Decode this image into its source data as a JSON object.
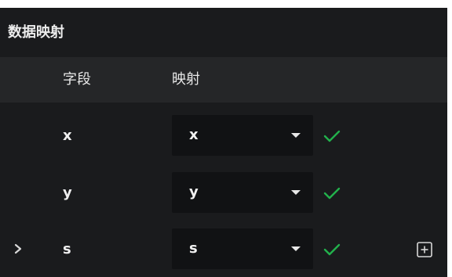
{
  "panel": {
    "title": "数据映射"
  },
  "table": {
    "headers": {
      "field": "字段",
      "mapping": "映射"
    },
    "rows": [
      {
        "field": "x",
        "mapping": "x",
        "status_icon": "check-icon"
      },
      {
        "field": "y",
        "mapping": "y",
        "status_icon": "check-icon"
      },
      {
        "field": "s",
        "mapping": "s",
        "status_icon": "check-icon",
        "expand_icon": "chevron-right-icon",
        "action_icon": "plus-box-icon"
      }
    ]
  },
  "colors": {
    "background": "#1a1b1d",
    "header_background": "#252628",
    "select_background": "#111214",
    "success": "#22b14c",
    "text": "#e6e6e6"
  }
}
